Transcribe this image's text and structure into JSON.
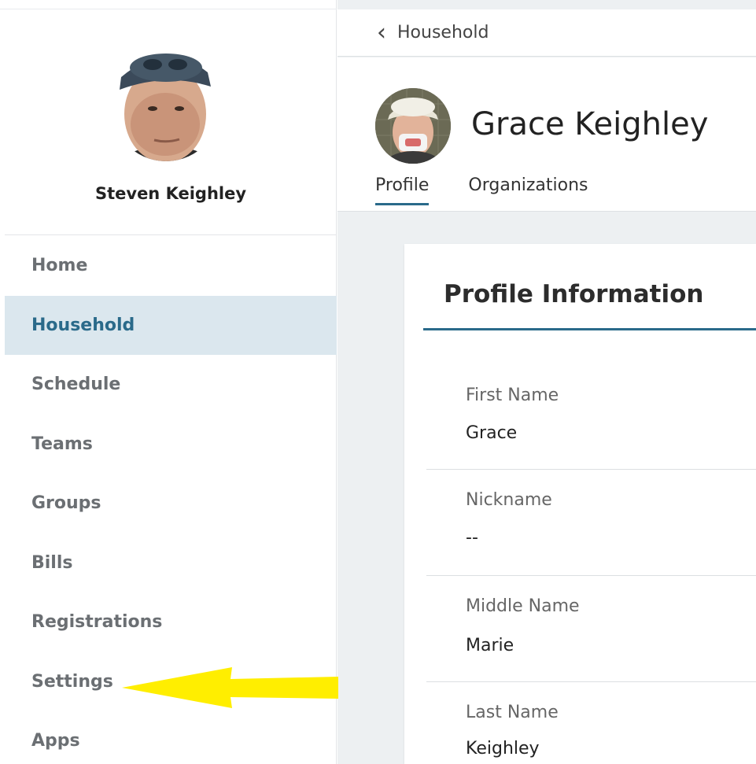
{
  "user": {
    "name": "Steven Keighley"
  },
  "nav": {
    "items": [
      {
        "label": "Home"
      },
      {
        "label": "Household"
      },
      {
        "label": "Schedule"
      },
      {
        "label": "Teams"
      },
      {
        "label": "Groups"
      },
      {
        "label": "Bills"
      },
      {
        "label": "Registrations"
      },
      {
        "label": "Settings"
      },
      {
        "label": "Apps"
      }
    ],
    "active": "Household"
  },
  "breadcrumb": {
    "back_icon": "chevron-left-icon",
    "label": "Household"
  },
  "member": {
    "name": "Grace Keighley"
  },
  "tabs": [
    {
      "label": "Profile"
    },
    {
      "label": "Organizations"
    }
  ],
  "card": {
    "title": "Profile Information",
    "fields": [
      {
        "label": "First Name",
        "value": "Grace"
      },
      {
        "label": "Nickname",
        "value": "--"
      },
      {
        "label": "Middle Name",
        "value": "Marie"
      },
      {
        "label": "Last Name",
        "value": "Keighley"
      }
    ]
  },
  "colors": {
    "accent": "#2a6a8a",
    "active_bg": "#dbe7ee",
    "annotation_arrow": "#ffee00"
  }
}
